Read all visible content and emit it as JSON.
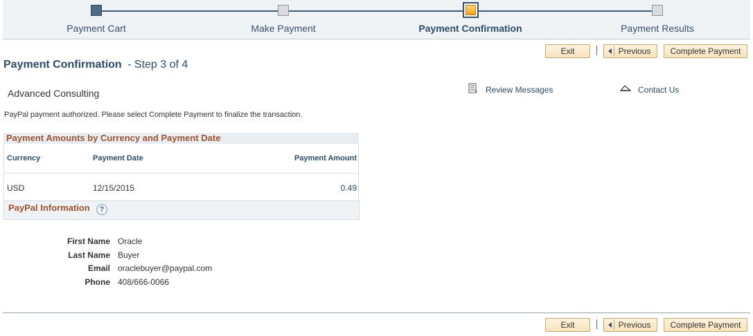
{
  "steps": [
    {
      "label": "Payment Cart",
      "state": "done"
    },
    {
      "label": "Make Payment",
      "state": "todo"
    },
    {
      "label": "Payment Confirmation",
      "state": "current"
    },
    {
      "label": "Payment Results",
      "state": "todo"
    }
  ],
  "buttons": {
    "exit": "Exit",
    "previous": "Previous",
    "complete": "Complete Payment"
  },
  "page": {
    "title": "Payment Confirmation",
    "step": "- Step 3 of 4",
    "org_name": "Advanced Consulting",
    "message": "PayPal payment authorized. Please select Complete Payment to finalize the transaction."
  },
  "links": {
    "review_messages": "Review Messages",
    "contact_us": "Contact Us"
  },
  "grid": {
    "title": "Payment Amounts by Currency and Payment Date",
    "headers": {
      "currency": "Currency",
      "date": "Payment Date",
      "amount": "Payment Amount"
    },
    "rows": [
      {
        "currency": "USD",
        "date": "12/15/2015",
        "amount": "0.49"
      }
    ]
  },
  "paypal": {
    "title": "PayPal Information",
    "help_icon": "?",
    "fields": [
      {
        "label": "First Name",
        "value": "Oracle"
      },
      {
        "label": "Last Name",
        "value": "Buyer"
      },
      {
        "label": "Email",
        "value": "oraclebuyer@paypal.com"
      },
      {
        "label": "Phone",
        "value": "408/666-0066"
      }
    ]
  },
  "colors": {
    "accent": "#2b4b6b",
    "section_title": "#a0522d",
    "button_bg": "#f7e3bc",
    "current_step": "#f4a21c"
  }
}
